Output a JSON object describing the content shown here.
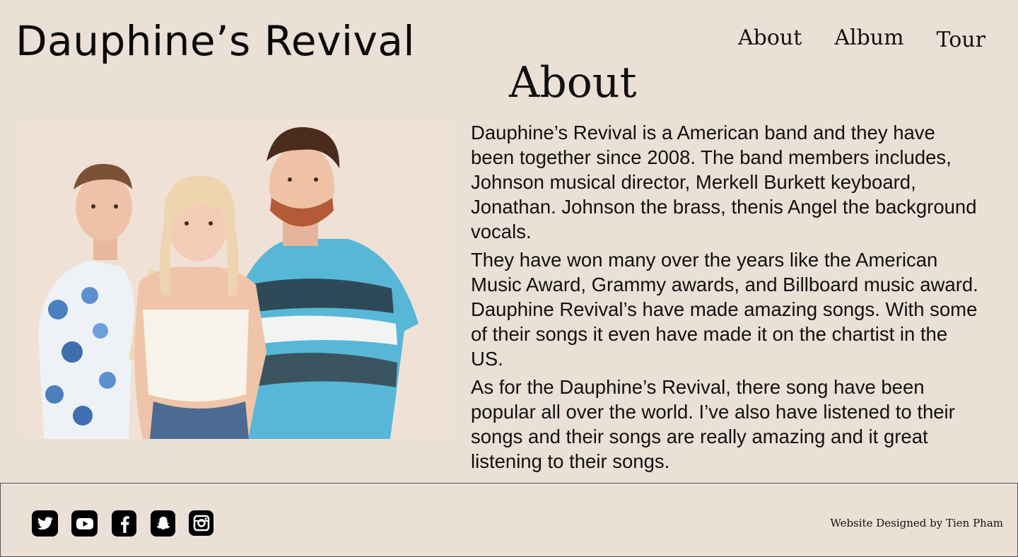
{
  "header": {
    "site_title": "Dauphine’s Revival",
    "nav": [
      "About",
      "Album",
      "Tour"
    ]
  },
  "about": {
    "heading": "About",
    "paragraphs": [
      "Dauphine’s Revival is a American band and they have been together since 2008. The band members includes, Johnson musical director, Merkell Burkett keyboard, Jonathan. Johnson the brass, thenis Angel the background vocals.",
      "They have won many over the years like the American Music Award, Grammy awards, and Billboard music award. Dauphine Revival’s have made amazing songs. With some of their songs it even have made it on the chartist in the US.",
      "As for the Dauphine’s Revival, there song have been popular all over the world. I’ve also have listened to their songs and their songs are really amazing and it great listening to their songs."
    ]
  },
  "footer": {
    "social_icons": [
      "twitter-icon",
      "youtube-icon",
      "facebook-icon",
      "snapchat-icon",
      "instagram-icon"
    ],
    "credit": "Website Designed by Tien Pham"
  },
  "colors": {
    "background": "#ebe0d6",
    "text": "#111111"
  }
}
